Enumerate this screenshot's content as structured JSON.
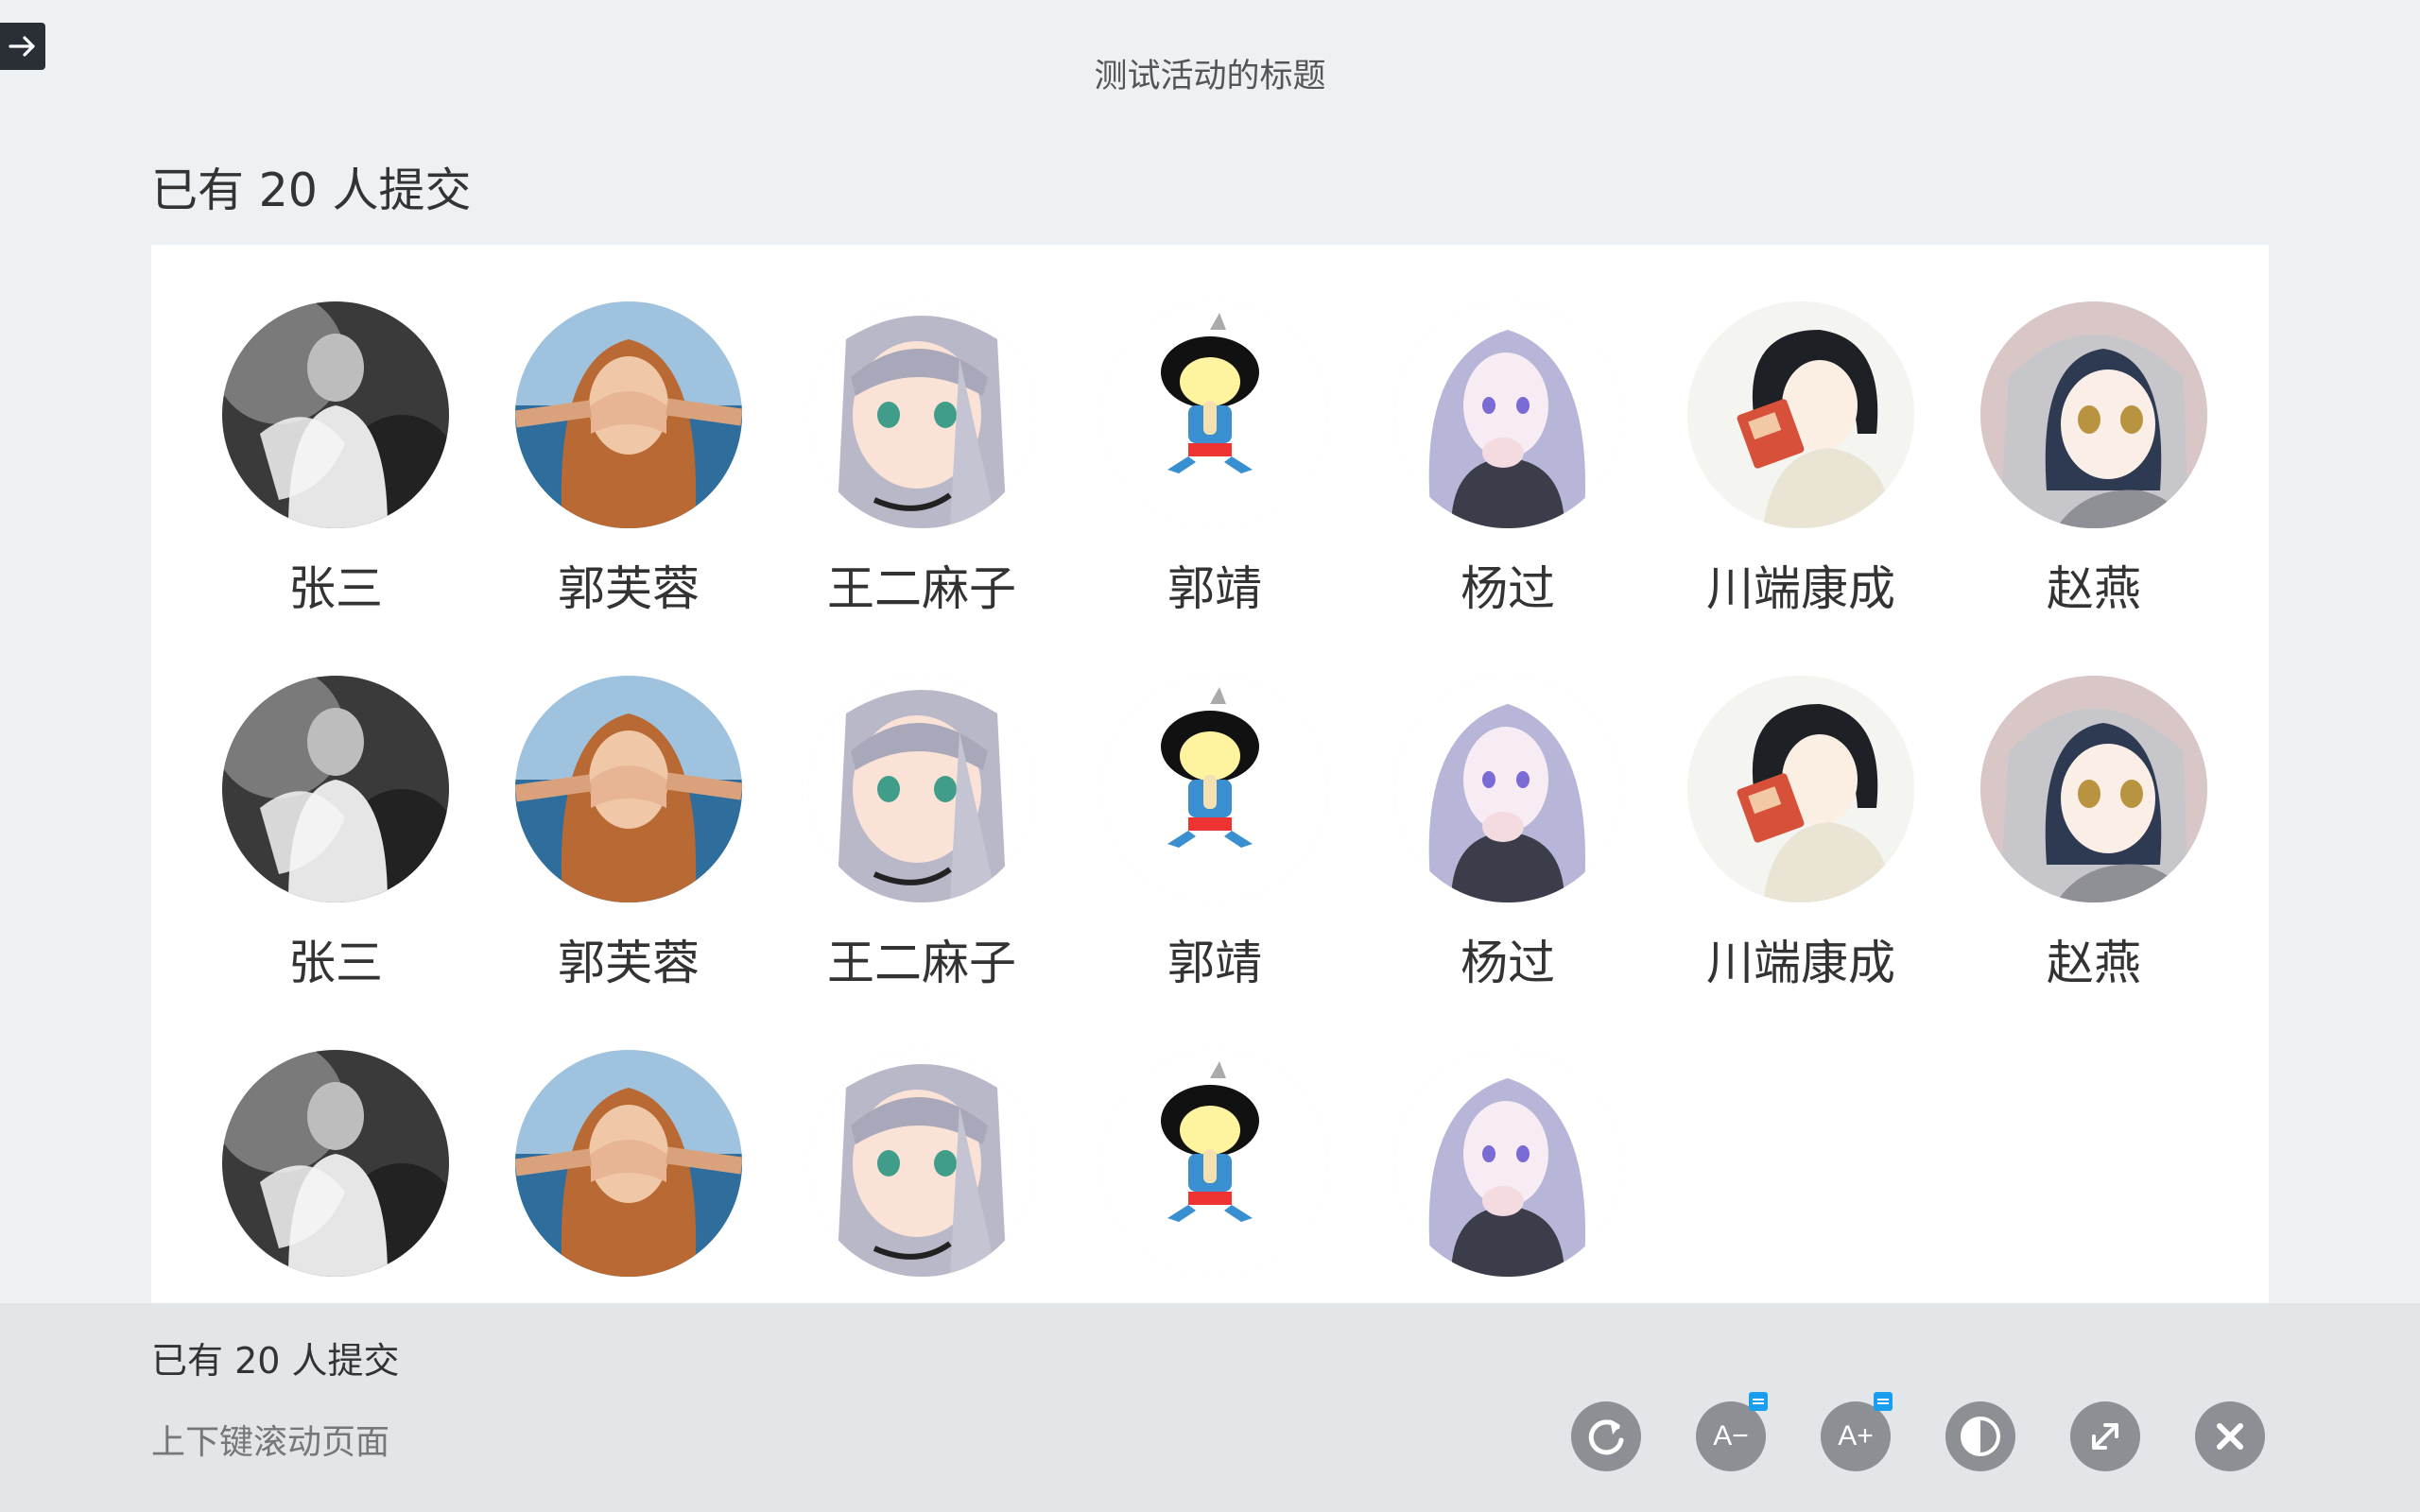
{
  "window": {
    "title": "测试活动的标题"
  },
  "heading": {
    "submitted_count_text": "已有 20 人提交"
  },
  "members": [
    {
      "name": "张三",
      "avatar": "avatar-bw-person"
    },
    {
      "name": "郭芙蓉",
      "avatar": "avatar-girl-hands-face"
    },
    {
      "name": "王二麻子",
      "avatar": "avatar-anime-silver-hair"
    },
    {
      "name": "郭靖",
      "avatar": "avatar-cartoon-kid"
    },
    {
      "name": "杨过",
      "avatar": "avatar-anime-purple-hair"
    },
    {
      "name": "川端康成",
      "avatar": "avatar-anime-drinking"
    },
    {
      "name": "赵燕",
      "avatar": "avatar-anime-hood"
    },
    {
      "name": "张三",
      "avatar": "avatar-bw-person"
    },
    {
      "name": "郭芙蓉",
      "avatar": "avatar-girl-hands-face"
    },
    {
      "name": "王二麻子",
      "avatar": "avatar-anime-silver-hair"
    },
    {
      "name": "郭靖",
      "avatar": "avatar-cartoon-kid"
    },
    {
      "name": "杨过",
      "avatar": "avatar-anime-purple-hair"
    },
    {
      "name": "川端康成",
      "avatar": "avatar-anime-drinking"
    },
    {
      "name": "赵燕",
      "avatar": "avatar-anime-hood"
    },
    {
      "name": "",
      "avatar": "avatar-bw-person"
    },
    {
      "name": "",
      "avatar": "avatar-girl-hands-face"
    },
    {
      "name": "",
      "avatar": "avatar-anime-silver-hair"
    },
    {
      "name": "",
      "avatar": "avatar-cartoon-kid"
    },
    {
      "name": "",
      "avatar": "avatar-anime-purple-hair"
    }
  ],
  "footer": {
    "submitted_count_text": "已有 20 人提交",
    "scroll_hint": "上下键滚动页面"
  },
  "toolbar": {
    "buttons": [
      {
        "name": "refresh-button",
        "icon": "refresh-icon"
      },
      {
        "name": "font-decrease-button",
        "icon": "font-decrease-icon",
        "label": "A−"
      },
      {
        "name": "font-increase-button",
        "icon": "font-increase-icon",
        "label": "A+"
      },
      {
        "name": "contrast-button",
        "icon": "contrast-icon"
      },
      {
        "name": "fullscreen-button",
        "icon": "expand-icon"
      },
      {
        "name": "close-button",
        "icon": "close-icon"
      }
    ]
  },
  "colors": {
    "background": "#eef1f3",
    "panel": "#ffffff",
    "footer": "#e2e6e9",
    "tool_button": "#8c8f93",
    "badge": "#1a9ef0"
  }
}
